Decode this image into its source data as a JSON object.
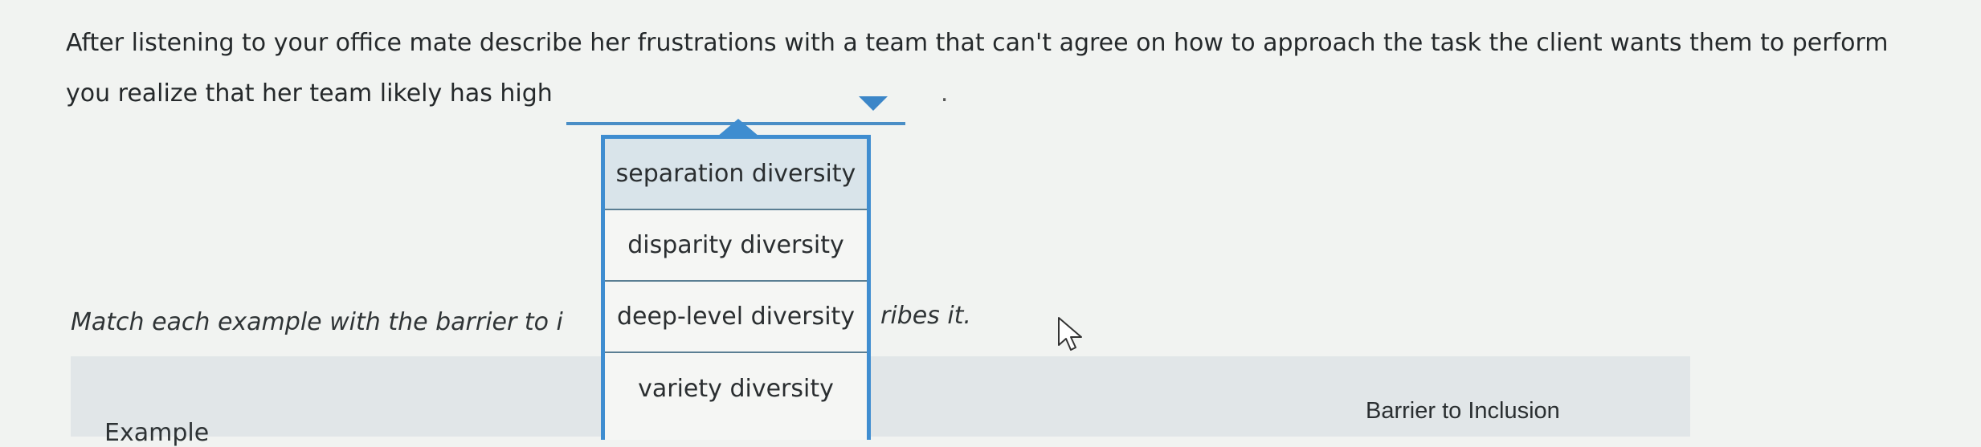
{
  "question": {
    "line1": "After listening to your office mate describe her frustrations with a team that can't agree on how to approach the task the client wants them to perform",
    "line2_prefix": "you realize that her team likely has high",
    "blank_value": "",
    "line2_suffix": "."
  },
  "dropdown": {
    "options": [
      "separation diversity",
      "disparity diversity",
      "deep-level diversity",
      "variety diversity"
    ],
    "highlighted_index": 0
  },
  "instruction": {
    "visible_left": "Match each example with the barrier to i",
    "visible_right": "ribes it."
  },
  "table": {
    "col_example": "Example",
    "col_barrier": "Barrier to Inclusion"
  },
  "colors": {
    "accent": "#3f8dd0",
    "highlight": "#d9e4ea"
  }
}
